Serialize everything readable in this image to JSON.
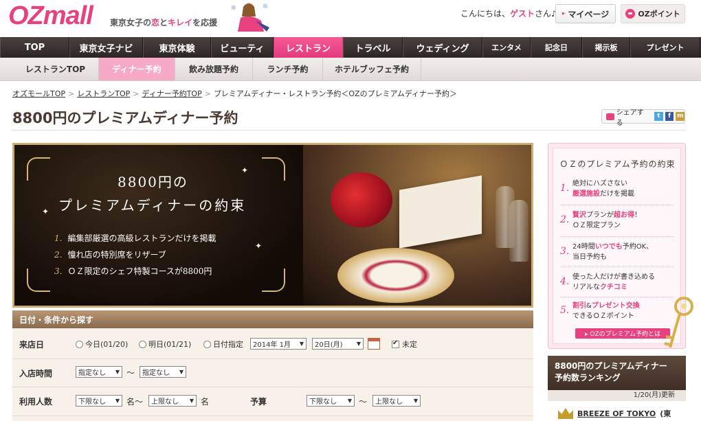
{
  "header": {
    "logo": "OZmall",
    "tagline_pre": "東京女子の",
    "tagline_koi": "恋",
    "tagline_to": "と",
    "tagline_kirei": "キレイ",
    "tagline_post": "を応援",
    "greeting_pre": "こんにちは、",
    "greeting_guest": "ゲスト",
    "greeting_post": "さん♪",
    "mypage_label": "マイページ",
    "ozpoint_label": "OZポイント"
  },
  "global_nav": [
    {
      "label": "TOP"
    },
    {
      "label": "東京女子ナビ"
    },
    {
      "label": "東京体験"
    },
    {
      "label": "ビューティ"
    },
    {
      "label": "レストラン"
    },
    {
      "label": "トラベル"
    },
    {
      "label": "ウェディング"
    },
    {
      "label": "エンタメ"
    },
    {
      "label": "記念日"
    },
    {
      "label": "掲示板"
    },
    {
      "label": "プレゼント"
    }
  ],
  "sub_nav": [
    {
      "label": "レストランTOP"
    },
    {
      "label": "ディナー予約"
    },
    {
      "label": "飲み放題予約"
    },
    {
      "label": "ランチ予約"
    },
    {
      "label": "ホテルブッフェ予約"
    }
  ],
  "breadcrumb": {
    "items": [
      "オズモールTOP",
      "レストランTOP",
      "ディナー予約TOP"
    ],
    "current": "プレミアムディナー・レストラン予約＜OZのプレミアムディナー予約＞",
    "separator": ">"
  },
  "page_title": "8800円のプレミアムディナー予約",
  "share": {
    "label": "シェアする",
    "twitter": "t",
    "facebook": "f",
    "mixi": "m"
  },
  "hero": {
    "title_line1": "8800円の",
    "title_line2": "プレミアムディナーの約束",
    "points": [
      {
        "num": "1.",
        "text": "編集部厳選の高級レストランだけを掲載"
      },
      {
        "num": "2.",
        "text": "憧れ店の特別席をリザーブ"
      },
      {
        "num": "3.",
        "text": "ＯＺ限定のシェフ特製コースが8800円"
      }
    ]
  },
  "search": {
    "heading": "日付・条件から探す",
    "visit_date": {
      "label": "来店日",
      "options": [
        "今日(01/20)",
        "明日(01/21)",
        "日付指定"
      ],
      "year_month": "2014年 1月",
      "day": "20日(月)",
      "undecided": "未定"
    },
    "entry_time": {
      "label": "入店時間",
      "from": "指定なし",
      "to": "指定なし",
      "tilde": "〜"
    },
    "people": {
      "label": "利用人数",
      "from": "下限なし",
      "unit_from": "名〜",
      "to": "上限なし",
      "unit_to": "名"
    },
    "budget": {
      "label": "予算",
      "from": "下限なし",
      "tilde": "〜",
      "to": "上限なし"
    }
  },
  "promise_box": {
    "title": "ＯＺのプレミアム予約の約束",
    "items": [
      {
        "num": "1.",
        "lines": [
          "絶対にハズさない",
          "厳選施設だけを掲載"
        ],
        "pink": "厳選施設"
      },
      {
        "num": "2.",
        "lines": [
          "贅沢プランが超お得！",
          "ＯＺ限定プラン"
        ],
        "pink": "贅沢"
      },
      {
        "num": "3.",
        "lines": [
          "24時間いつでも予約OK、",
          "当日予約も"
        ],
        "pink": "いつでも"
      },
      {
        "num": "4.",
        "lines": [
          "使った人だけが書き込める",
          "リアルなクチコミ"
        ],
        "pink": "クチコミ"
      },
      {
        "num": "5.",
        "lines": [
          "割引&プレゼント交換",
          "できるＯＺポイント"
        ],
        "pink": "割引"
      }
    ],
    "link_label": "▸ OZのプレミアム予約とは"
  },
  "ranking": {
    "heading_line1": "8800円のプレミアムディナー",
    "heading_line2": "予約数ランキング",
    "updated": "1/20(月)更新",
    "first": "BREEZE OF TOKYO",
    "first_suffix": "(東"
  },
  "colors": {
    "brand_pink": "#e8417f",
    "nav_dark": "#2e2626",
    "gold": "#c9ae76",
    "search_brown": "#8a6b4f"
  }
}
